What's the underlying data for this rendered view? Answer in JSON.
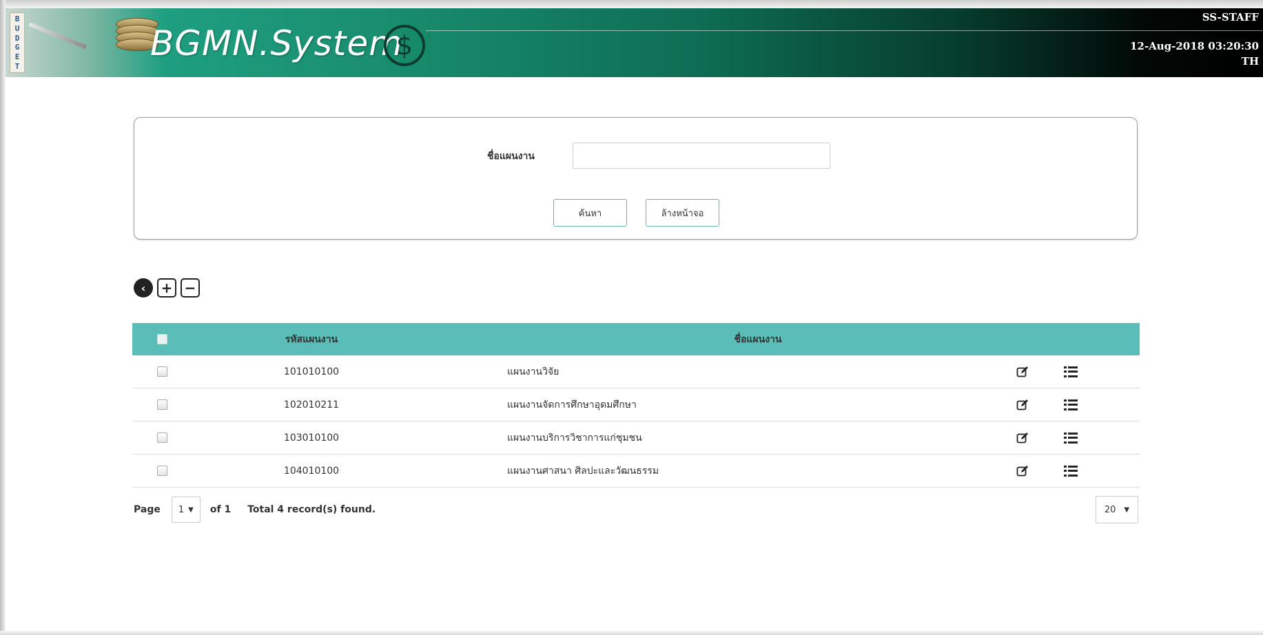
{
  "header": {
    "budget_letters": [
      "B",
      "U",
      "D",
      "G",
      "E",
      "T"
    ],
    "brand": "BGMN.System",
    "currency_symbol": "$",
    "user": "SS-STAFF",
    "datetime": "12-Aug-2018 03:20:30",
    "language": "TH"
  },
  "search": {
    "label": "ชื่อแผนงาน",
    "value": "",
    "placeholder": "",
    "search_button": "ค้นหา",
    "clear_button": "ล้างหน้าจอ"
  },
  "toolbar": {
    "back_icon": "chevron-left-circle-icon",
    "add_icon": "plus-square-icon",
    "remove_icon": "minus-square-icon",
    "back_glyph": "‹",
    "add_glyph": "+",
    "remove_glyph": "−"
  },
  "table": {
    "columns": [
      "รหัสแผนงาน",
      "ชื่อแผนงาน"
    ],
    "rows": [
      {
        "code": "101010100",
        "name": "แผนงานวิจัย"
      },
      {
        "code": "102010211",
        "name": "แผนงานจัดการศึกษาอุดมศึกษา"
      },
      {
        "code": "103010100",
        "name": "แผนงานบริการวิชาการแก่ชุมชน"
      },
      {
        "code": "104010100",
        "name": "แผนงานศาสนา ศิลปะและวัฒนธรรม"
      }
    ]
  },
  "pager": {
    "page_label": "Page",
    "current_page": "1",
    "of_text": "of 1",
    "total_text": "Total 4 record(s) found.",
    "page_size": "20"
  },
  "colors": {
    "table_header": "#5bbdb8",
    "button_border": "#5fb8b2",
    "header_dark": "#000000",
    "header_green": "#1e9f80"
  }
}
